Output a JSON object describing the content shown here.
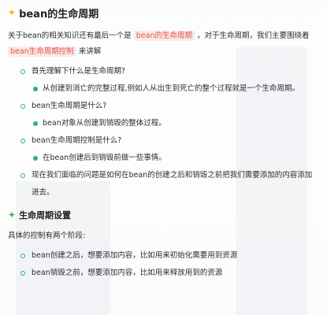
{
  "title": "bean的生命周期",
  "intro": {
    "part1": "关于bean的相关知识还有最后一个是 ",
    "highlight1": "bean的生命周期",
    "part2": " ，对于生命周期，我们主要围绕着 ",
    "highlight2": "bean生命周期控制",
    "part3": " 来讲解"
  },
  "questions": [
    {
      "label": "首先理解下什么是生命周期?",
      "sub": "从创建到消亡的完整过程,例如人从出生到死亡的整个过程就是一个生命周期。"
    },
    {
      "label": "bean生命周期是什么?",
      "sub": "bean对象从创建到销毁的整体过程。"
    },
    {
      "label": "bean生命周期控制是什么?",
      "sub": "在bean创建后到销毁前做一些事情。"
    }
  ],
  "problem": "现在我们面临的问题是如何在bean的创建之后和销毁之前把我们需要添加的内容添加进去。",
  "section2": {
    "title": "生命周期设置",
    "intro": "具体的控制有两个阶段:",
    "items": [
      "bean创建之后，想要添加内容，比如用来初始化需要用到资源",
      "bean销毁之前，想要添加内容，比如用来释放用到的资源"
    ]
  }
}
